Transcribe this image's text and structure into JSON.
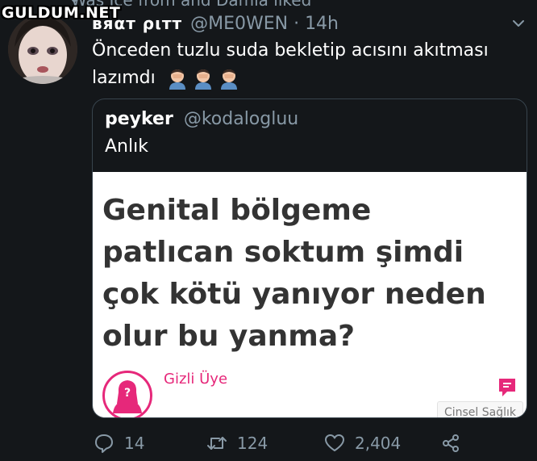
{
  "watermark": "GULDUM.NET",
  "context": {
    "text": "Was Ice from and Damla liked"
  },
  "tweet": {
    "display_name": "вяαт ριтт",
    "handle_time": "@ME0WEN · 14h",
    "text_line1": "Önceden tuzlu suda bekletip acısını akıtması",
    "text_line2": "lazımdı",
    "emoji": "man-facepalming"
  },
  "quote": {
    "name": "peyker",
    "handle": "@kodalogluu",
    "text": "Anlık",
    "image": {
      "question": "Genital bölgeme patlıcan soktum şimdi çok kötü yanıyor neden olur bu yanma?",
      "user_name": "Gizli Üye",
      "avatar_mark": "?",
      "category": "Cinsel Sağlık",
      "accent_color": "#e6287a"
    }
  },
  "actions": {
    "reply_count": "14",
    "retweet_count": "124",
    "like_count": "2,404"
  },
  "colors": {
    "background": "#14171a",
    "secondary_text": "#8899a6",
    "border": "#38444d"
  }
}
